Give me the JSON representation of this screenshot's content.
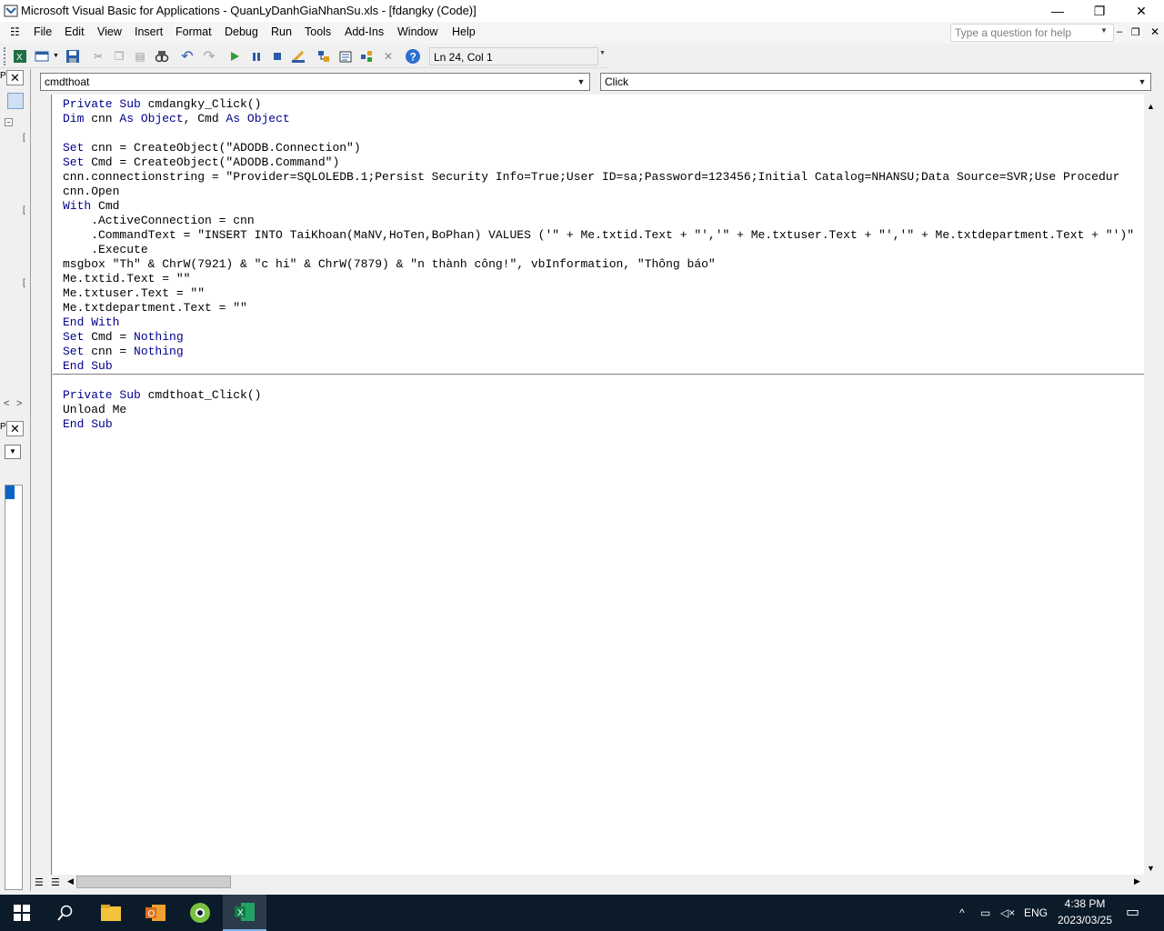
{
  "window": {
    "title": "Microsoft Visual Basic for Applications - QuanLyDanhGiaNhanSu.xls - [fdangky (Code)]",
    "minimize": "—",
    "restore": "❐",
    "close": "✕"
  },
  "menu": {
    "items": [
      "File",
      "Edit",
      "View",
      "Insert",
      "Format",
      "Debug",
      "Run",
      "Tools",
      "Add-Ins",
      "Window",
      "Help"
    ],
    "help_placeholder": "Type a question for help"
  },
  "toolbar": {
    "cursor_position": "Ln 24, Col 1"
  },
  "code_window": {
    "object_combo": "cmdthoat",
    "procedure_combo": "Click",
    "proc1": {
      "l1": "Private Sub cmdangky_Click()",
      "l2": "Dim cnn As Object, Cmd As Object",
      "l3": "",
      "l4": "Set cnn = CreateObject(\"ADODB.Connection\")",
      "l5": "Set Cmd = CreateObject(\"ADODB.Command\")",
      "l6": "cnn.connectionstring = \"Provider=SQLOLEDB.1;Persist Security Info=True;User ID=sa;Password=123456;Initial Catalog=NHANSU;Data Source=SVR;Use Procedur",
      "l7": "cnn.Open",
      "l8": "With Cmd",
      "l9": "    .ActiveConnection = cnn",
      "l10": "    .CommandText = \"INSERT INTO TaiKhoan(MaNV,HoTen,BoPhan) VALUES ('\" + Me.txtid.Text + \"','\" + Me.txtuser.Text + \"','\" + Me.txtdepartment.Text + \"')\"",
      "l11": "    .Execute",
      "l12": "msgbox \"Th\" & ChrW(7921) & \"c hi\" & ChrW(7879) & \"n thành công!\", vbInformation, \"Thông báo\"",
      "l13": "Me.txtid.Text = \"\"",
      "l14": "Me.txtuser.Text = \"\"",
      "l15": "Me.txtdepartment.Text = \"\"",
      "l16": "End With",
      "l17": "Set Cmd = Nothing",
      "l18": "Set cnn = Nothing",
      "l19": "End Sub"
    },
    "proc2": {
      "l1": "Private Sub cmdthoat_Click()",
      "l2": "Unload Me",
      "l3": "End Sub"
    }
  },
  "taskbar": {
    "language": "ENG",
    "time": "4:38 PM",
    "date": "2023/03/25"
  },
  "colors": {
    "keyword": "#00008b",
    "taskbar": "#0c1b2a"
  }
}
